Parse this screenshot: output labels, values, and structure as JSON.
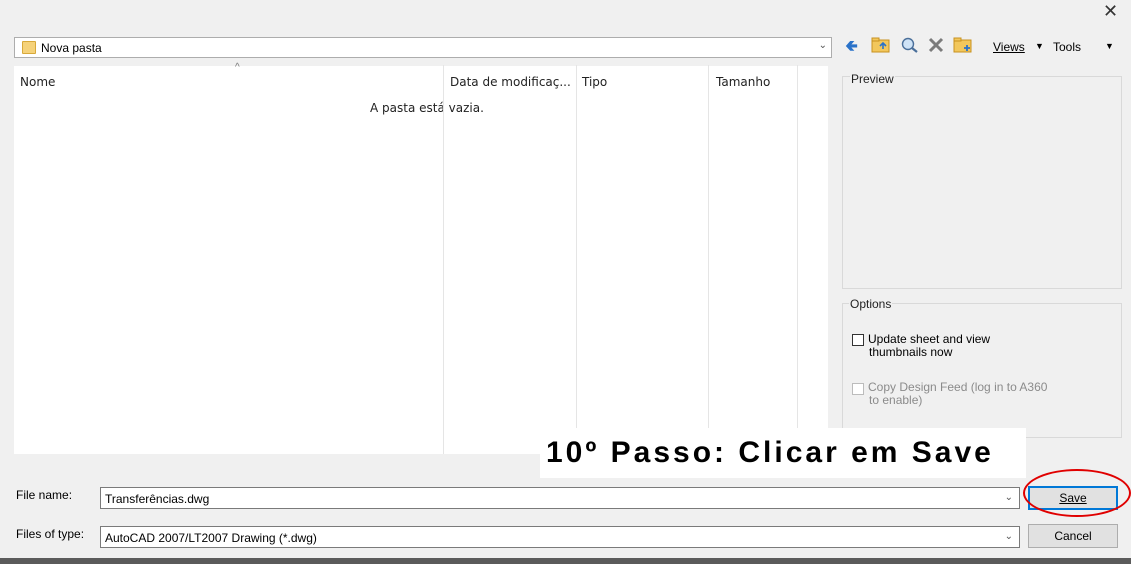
{
  "window": {
    "close_glyph": "✕"
  },
  "pathbar": {
    "folder_label": "Nova pasta",
    "folder_icon": "folder-icon"
  },
  "toolbar": {
    "back_icon": "back-arrow-icon",
    "up_folder_icon": "up-folder-icon",
    "search_icon": "search-web-icon",
    "delete_icon": "delete-icon",
    "new_folder_icon": "new-folder-icon",
    "views_label": "Views",
    "tools_label": "Tools"
  },
  "filelist": {
    "columns": [
      "Nome",
      "Data de modificaç...",
      "Tipo",
      "Tamanho"
    ],
    "empty_message": "A pasta está vazia."
  },
  "preview": {
    "title": "Preview"
  },
  "options": {
    "title": "Options",
    "update_thumbnails": {
      "label_line1": "Update sheet and view",
      "label_line2": "thumbnails now",
      "checked": false,
      "enabled": true
    },
    "copy_design_feed": {
      "label_line1": "Copy Design Feed (log in to A360",
      "label_line2": "to enable)",
      "checked": false,
      "enabled": false
    }
  },
  "annotation": {
    "step_text": "10º Passo: Clicar em Save",
    "highlight_color": "#e00000"
  },
  "filename": {
    "label": "File name:",
    "value": "Transferências.dwg"
  },
  "filetype": {
    "label": "Files of type:",
    "value": "AutoCAD 2007/LT2007 Drawing (*.dwg)"
  },
  "buttons": {
    "save_label": "Save",
    "cancel_label": "Cancel"
  },
  "colors": {
    "accent": "#0078d7",
    "window_bg": "#f0f0f0"
  }
}
